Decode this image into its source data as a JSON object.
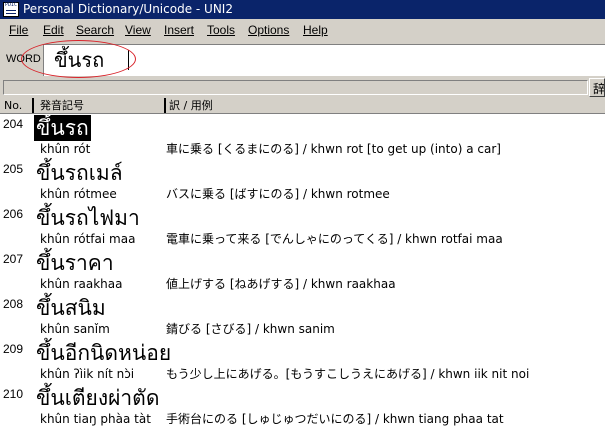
{
  "window": {
    "title": "Personal Dictionary/Unicode - UNI2",
    "icon_text": "PDIC"
  },
  "menu": [
    {
      "label": "File"
    },
    {
      "label": "Edit"
    },
    {
      "label": "Search"
    },
    {
      "label": "View"
    },
    {
      "label": "Insert"
    },
    {
      "label": "Tools"
    },
    {
      "label": "Options"
    },
    {
      "label": "Help"
    }
  ],
  "search": {
    "label": "WORD",
    "value": "ขึ้นรถ",
    "highlight_color": "#d8232a"
  },
  "toolbar": {
    "right_button_label": "辞"
  },
  "columns": {
    "no": "No.",
    "pron": "発音記号",
    "trans": "訳 / 用例"
  },
  "entries": [
    {
      "no": "204",
      "word": "ขึ้นรถ",
      "pron": "khûn rót",
      "trans": "車に乗る [くるまにのる] / khwn rot [to get up (into) a car]",
      "selected": true
    },
    {
      "no": "205",
      "word": "ขึ้นรถเมล์",
      "pron": "khûn rótmee",
      "trans": "バスに乗る [ばすにのる] / khwn rotmee",
      "selected": false
    },
    {
      "no": "206",
      "word": "ขึ้นรถไฟมา",
      "pron": "khûn rótfai maa",
      "trans": "電車に乗って来る [でんしゃにのってくる] / khwn rotfai maa",
      "selected": false
    },
    {
      "no": "207",
      "word": "ขึ้นราคา",
      "pron": "khûn raakhaa",
      "trans": "値上げする [ねあげする] / khwn raakhaa",
      "selected": false
    },
    {
      "no": "208",
      "word": "ขึ้นสนิม",
      "pron": "khûn sanǐm",
      "trans": "錆びる [さびる] / khwn sanim",
      "selected": false
    },
    {
      "no": "209",
      "word": "ขึ้นอีกนิดหน่อย",
      "pron": "khûn ʔìik nít nɔ̀i",
      "trans": "もう少し上にあげる。[もうすこしうえにあげる] / khwn iik nit noi",
      "selected": false
    },
    {
      "no": "210",
      "word": "ขึ้นเตียงผ่าตัด",
      "pron": "khûn tiaŋ phàa tàt",
      "trans": "手術台にのる [しゅじゅつだいにのる] / khwn tiang phaa tat",
      "selected": false
    }
  ]
}
